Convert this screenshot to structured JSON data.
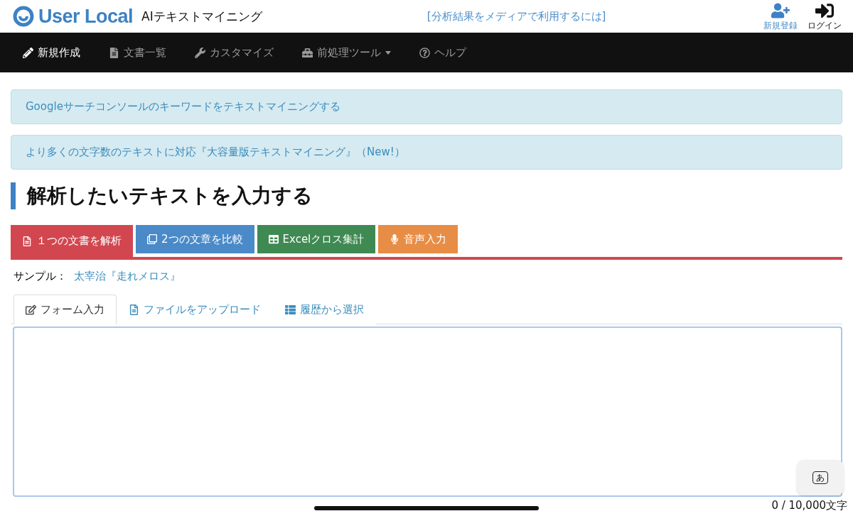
{
  "header": {
    "logo": "User Local",
    "product": "AIテキストマイニング",
    "media_link": "[分析結果をメディアで利用するには]",
    "actions": [
      {
        "kind": "signup",
        "label": "新規登録"
      },
      {
        "kind": "login",
        "label": "ログイン"
      }
    ]
  },
  "nav": {
    "items": [
      {
        "label": "新規作成",
        "selected": true,
        "dropdown": false
      },
      {
        "label": "文書一覧",
        "selected": false,
        "dropdown": false
      },
      {
        "label": "カスタマイズ",
        "selected": false,
        "dropdown": false
      },
      {
        "label": "前処理ツール",
        "selected": false,
        "dropdown": true
      },
      {
        "label": "ヘルプ",
        "selected": false,
        "dropdown": false
      }
    ]
  },
  "notices": [
    "Googleサーチコンソールのキーワードをテキストマイニングする",
    "より多くの文字数のテキストに対応『大容量版テキストマイニング』（New!）"
  ],
  "heading": "解析したいテキストを入力する",
  "mode_tabs": [
    {
      "label": "１つの文書を解析",
      "color": "#d2474f",
      "selected": true
    },
    {
      "label": "2つの文章を比較",
      "color": "#4a8ac9",
      "selected": false
    },
    {
      "label": "Excelクロス集計",
      "color": "#3f8a52",
      "selected": false
    },
    {
      "label": "音声入力",
      "color": "#e88d45",
      "selected": false
    }
  ],
  "sample": {
    "label": "サンプル：",
    "link": "太宰治『走れメロス』"
  },
  "input_tabs": [
    {
      "label": "フォーム入力",
      "selected": true
    },
    {
      "label": "ファイルをアップロード",
      "selected": false
    },
    {
      "label": "履歴から選択",
      "selected": false
    }
  ],
  "keyboard_key": "あ",
  "counter": "0 / 10,000文字"
}
